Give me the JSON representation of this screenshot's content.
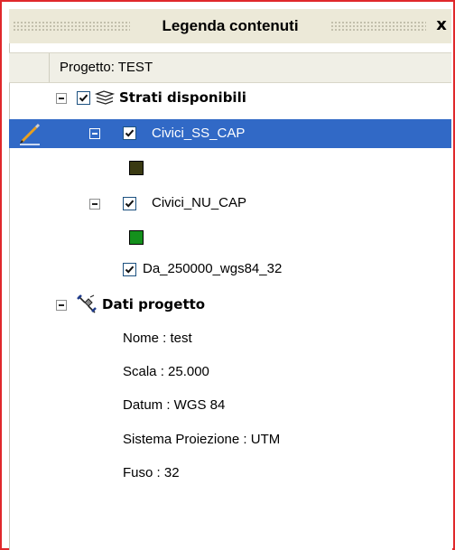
{
  "window": {
    "title": "Legenda contenuti",
    "close_glyph": "x"
  },
  "project": {
    "label": "Progetto: TEST"
  },
  "layers_group": {
    "label": "Strati disponibili",
    "icon": "layers-stack-icon",
    "checked": true,
    "layers": [
      {
        "label": "Civici_SS_CAP",
        "checked": true,
        "selected": true,
        "editing_icon": "pencil-icon",
        "swatch_color": "#3a3a12"
      },
      {
        "label": "Civici_NU_CAP",
        "checked": true,
        "selected": false,
        "swatch_color": "#14901c"
      },
      {
        "label": "Da_250000_wgs84_32",
        "checked": true,
        "selected": false
      }
    ]
  },
  "project_data": {
    "label": "Dati progetto",
    "icon": "satellite-icon",
    "fields": [
      "Nome : test",
      "Scala : 25.000",
      "Datum : WGS 84",
      "Sistema Proiezione : UTM",
      "Fuso : 32"
    ]
  },
  "colors": {
    "frame_border": "#e0282b",
    "selection": "#3169c6",
    "titlebar_bg": "#ece9d8"
  }
}
